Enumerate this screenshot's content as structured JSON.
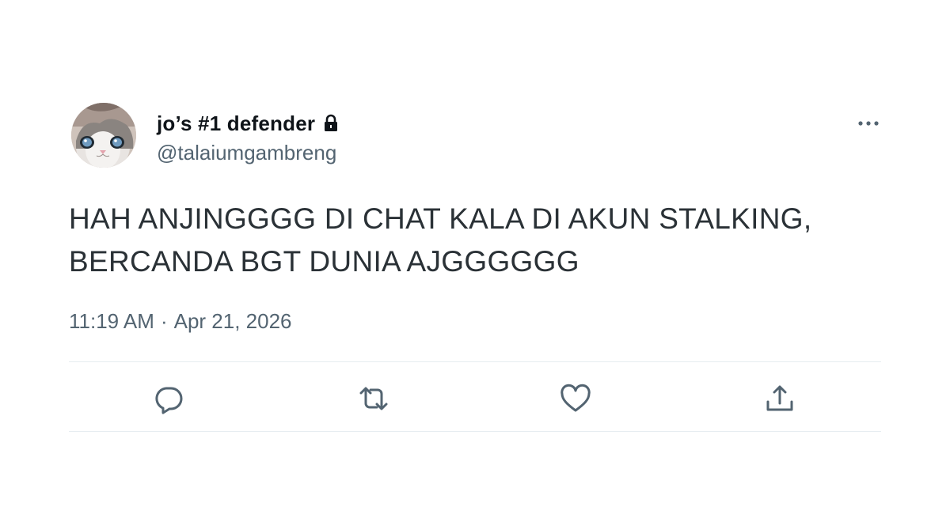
{
  "author": {
    "display_name": "jo’s #1 defender",
    "handle": "@talaiumgambreng",
    "protected_icon": "lock-icon",
    "avatar": "cat-photo-avatar"
  },
  "tweet": {
    "text_lines": [
      "HAH ANJINGGGG DI CHAT KALA DI AKUN STALKING,",
      "BERCANDA BGT DUNIA AJGGGGGG"
    ],
    "time": "11:19 AM",
    "separator": "·",
    "date": "Apr 21, 2026"
  },
  "actions": {
    "more_icon": "more-icon",
    "reply_icon": "reply-icon",
    "retweet_icon": "retweet-icon",
    "like_icon": "like-icon",
    "share_icon": "share-icon"
  },
  "colors": {
    "text_primary": "#0f1419",
    "text_secondary": "#536471",
    "icon": "#536471",
    "divider": "#e6ecf0"
  }
}
